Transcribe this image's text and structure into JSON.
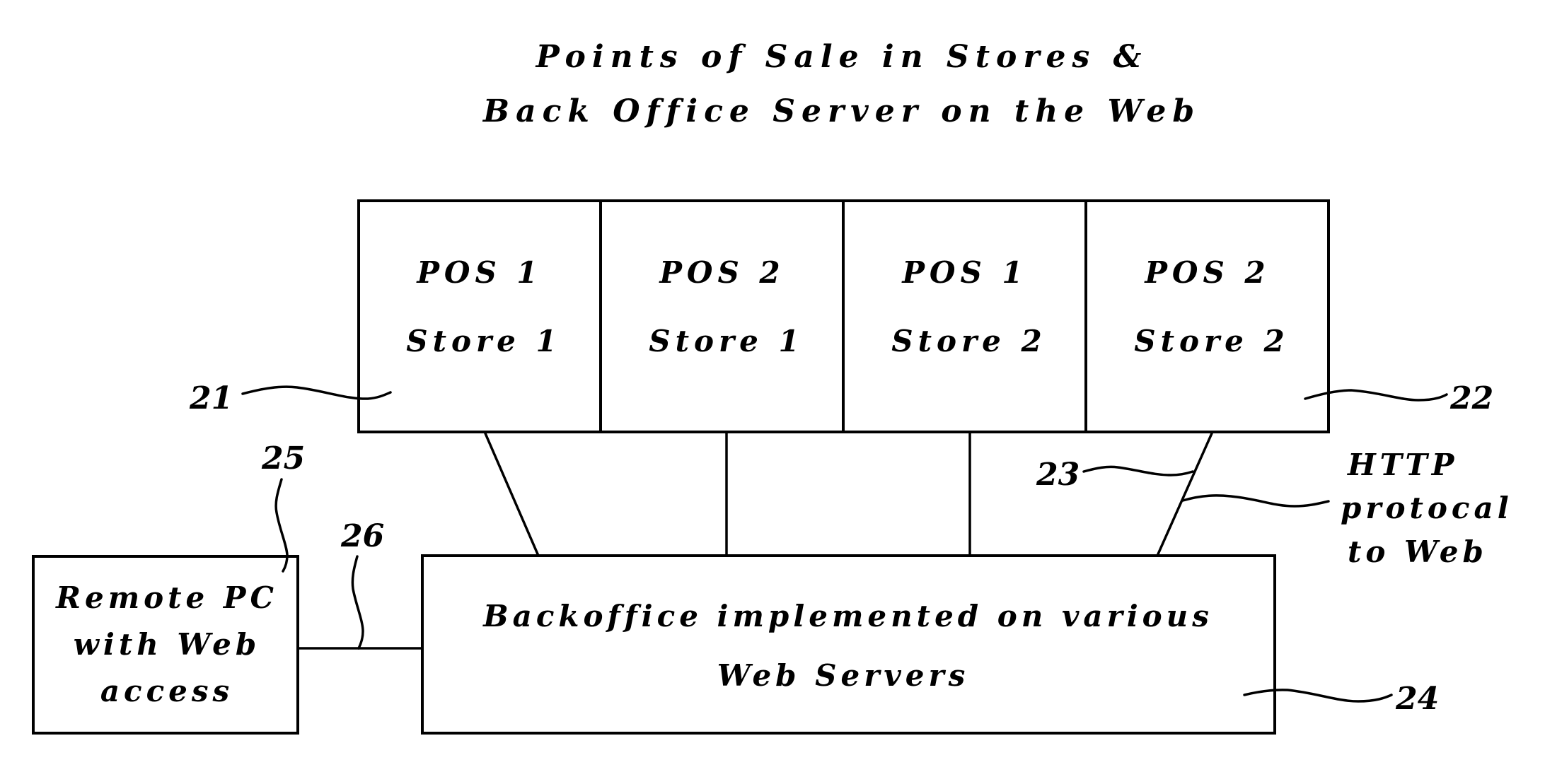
{
  "title": {
    "line1": "Points of Sale in Stores &",
    "line2": "Back Office Server on the Web"
  },
  "pos_terminals": [
    {
      "pos": "POS 1",
      "store": "Store 1"
    },
    {
      "pos": "POS 2",
      "store": "Store 1"
    },
    {
      "pos": "POS 1",
      "store": "Store 2"
    },
    {
      "pos": "POS 2",
      "store": "Store 2"
    }
  ],
  "backoffice": {
    "line1": "Backoffice implemented on various",
    "line2": "Web Servers"
  },
  "remote_pc": {
    "line1": "Remote PC",
    "line2": "with Web",
    "line3": "access"
  },
  "http_note": {
    "line1": "HTTP",
    "line2": "protocal",
    "line3": "to Web"
  },
  "reference_numerals": {
    "pos_group_left": "21",
    "pos_group_right": "22",
    "connection": "23",
    "backoffice": "24",
    "remote_pc": "25",
    "remote_link": "26"
  }
}
